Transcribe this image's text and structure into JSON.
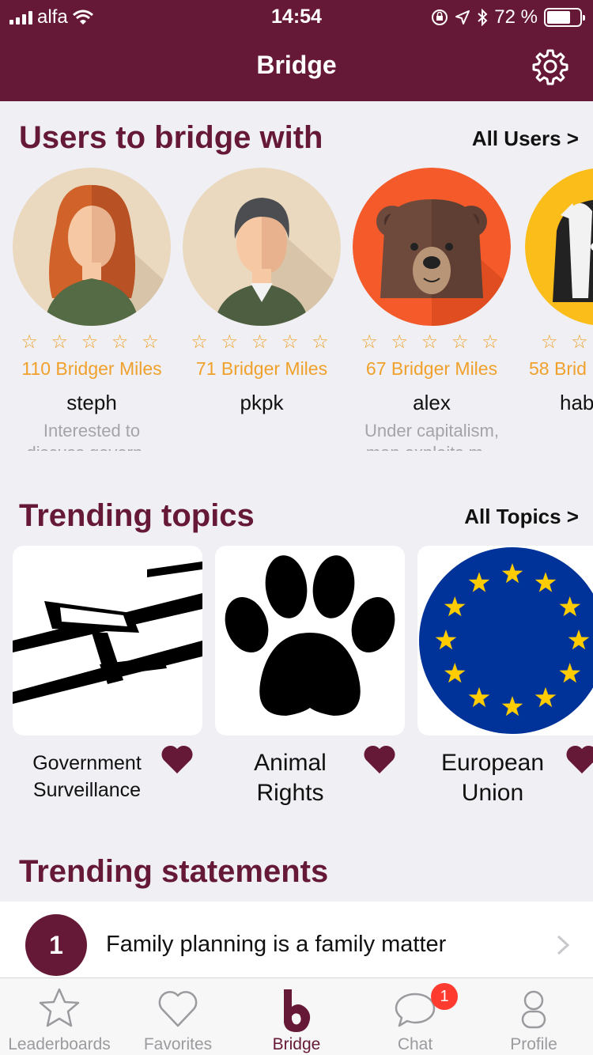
{
  "status_bar": {
    "carrier": "alfa",
    "time": "14:54",
    "battery": "72 %",
    "battery_level": 0.72
  },
  "nav": {
    "title": "Bridge"
  },
  "users_section": {
    "title": "Users to bridge with",
    "see_all": "All Users >",
    "users": [
      {
        "miles": "110 Bridger Miles",
        "name": "steph",
        "bio": "Interested to discuss govern...",
        "rating": 0
      },
      {
        "miles": "71 Bridger Miles",
        "name": "pkpk",
        "bio": "",
        "rating": 0
      },
      {
        "miles": "67 Bridger Miles",
        "name": "alex",
        "bio": "Under capitalism, man exploits m...",
        "rating": 0
      },
      {
        "miles": "58 Brid",
        "name": "hab",
        "bio": "",
        "rating": 0
      }
    ],
    "stars": "☆ ☆ ☆ ☆ ☆"
  },
  "topics_section": {
    "title": "Trending topics",
    "see_all": "All Topics >",
    "topics": [
      {
        "line1": "Government",
        "line2": "Surveillance"
      },
      {
        "line1": "Animal",
        "line2": "Rights"
      },
      {
        "line1": "European",
        "line2": "Union"
      }
    ]
  },
  "statements_section": {
    "title": "Trending statements",
    "items": [
      {
        "rank": "1",
        "text": "Family planning is a family matter"
      }
    ]
  },
  "tabbar": {
    "tabs": [
      {
        "label": "Leaderboards",
        "icon": "star-icon"
      },
      {
        "label": "Favorites",
        "icon": "heart-icon"
      },
      {
        "label": "Bridge",
        "icon": "bridge-logo-icon",
        "active": true
      },
      {
        "label": "Chat",
        "icon": "chat-icon",
        "badge": "1"
      },
      {
        "label": "Profile",
        "icon": "person-icon"
      }
    ]
  },
  "colors": {
    "brand": "#661936",
    "accent": "#f0a12b",
    "background": "#efeff4"
  }
}
